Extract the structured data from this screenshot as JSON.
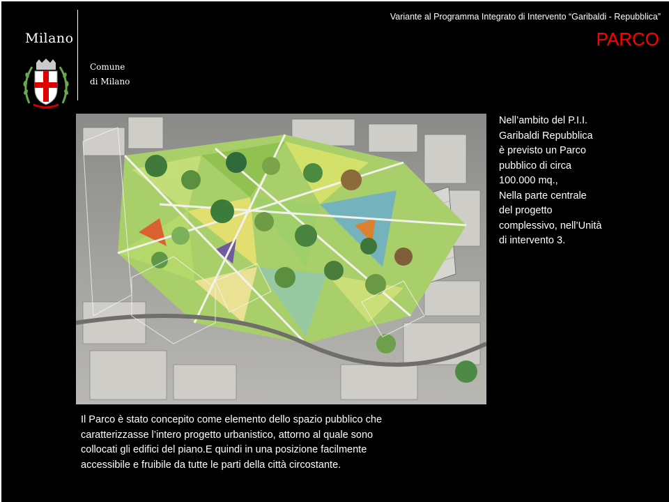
{
  "header": {
    "logo_text": "Milano",
    "comune_line1": "Comune",
    "comune_line2": "di Milano",
    "title": "Variante al Programma Integrato di Intervento “Garibaldi - Repubblica”",
    "section": "PARCO"
  },
  "colors": {
    "background": "#000000",
    "text": "#ffffff",
    "accent": "#ff0000"
  },
  "side_text": [
    "Nell’ambito del P.I.I.",
    "Garibaldi Repubblica",
    "è previsto un Parco",
    "pubblico di circa",
    "100.000 mq.,",
    "Nella parte centrale",
    "del progetto",
    "complessivo, nell’Unità",
    "di intervento 3."
  ],
  "bottom_text": [
    "Il Parco è stato concepito come elemento dello spazio pubblico che",
    "caratterizzasse l’intero progetto urbanistico, attorno al quale sono",
    "collocati gli edifici del piano.E  quindi in una posizione facilmente",
    "accessibile e fruibile da tutte le parti della città circostante."
  ]
}
